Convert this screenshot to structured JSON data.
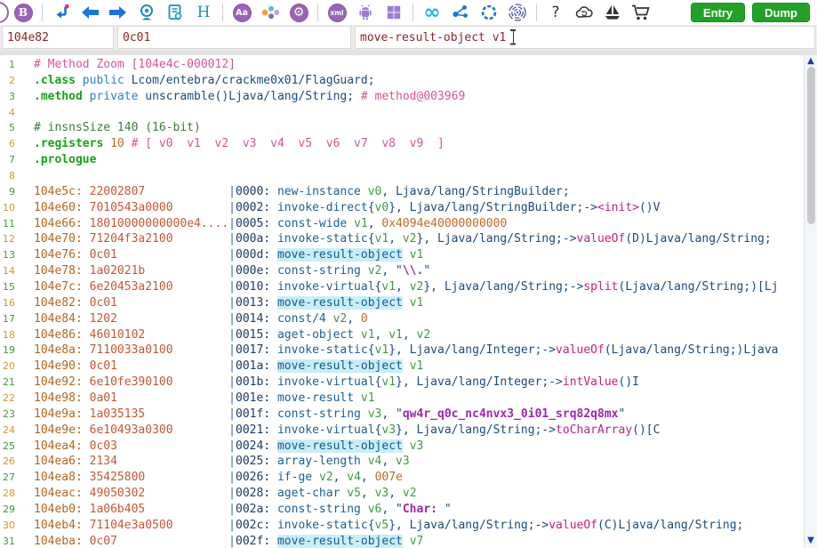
{
  "toolbar": {
    "glyphs": {
      "b_badge": "B",
      "font_case": "Aa",
      "settings_gear": "⚙",
      "xml_badge": "xml",
      "heading_h": "H",
      "infinity": "∞",
      "help": "?"
    },
    "buttons": [
      {
        "label": "Entry"
      },
      {
        "label": "Dump"
      }
    ]
  },
  "search": {
    "fields": [
      {
        "value": "104e82"
      },
      {
        "value": "0c01"
      },
      {
        "value": "move-result-object v1"
      }
    ]
  },
  "scrollbar": {
    "up": "▲",
    "down": "▼"
  },
  "colors": {
    "button_green": "#23a127",
    "search_text": "#8b2525",
    "highlight_bg": "#c9eef8",
    "accent_purple": "#9a63b5",
    "accent_teal": "#1f8fb5",
    "accent_blue": "#1b74d8"
  },
  "editor": {
    "highlight_term": "move-result-object",
    "lines": [
      {
        "no": 1,
        "tokens": [
          [
            "cpk",
            "# Method Zoom [104e4c-000012]"
          ]
        ]
      },
      {
        "no": 2,
        "tokens": [
          [
            "kw",
            ".class"
          ],
          [
            "pl",
            " "
          ],
          [
            "mod",
            "public"
          ],
          [
            "pl",
            " Lcom/entebra/crackme0x01/FlagGuard;"
          ]
        ]
      },
      {
        "no": 3,
        "tokens": [
          [
            "kw",
            ".method"
          ],
          [
            "pl",
            " "
          ],
          [
            "mod",
            "private"
          ],
          [
            "pl",
            " unscramble()Ljava/lang/String; "
          ],
          [
            "cpk",
            "# method@003969"
          ]
        ]
      },
      {
        "no": 4,
        "tokens": []
      },
      {
        "no": 5,
        "tokens": [
          [
            "cgr",
            "# insnsSize 140 (16-bit)"
          ]
        ]
      },
      {
        "no": 6,
        "tokens": [
          [
            "kw",
            ".registers"
          ],
          [
            "pl",
            " "
          ],
          [
            "num",
            "10"
          ],
          [
            "pl",
            " "
          ],
          [
            "cpk",
            "# [ v0  v1  v2  v3  v4  v5  v6  v7  v8  v9  ]"
          ]
        ]
      },
      {
        "no": 7,
        "tokens": [
          [
            "kw",
            ".prologue"
          ]
        ]
      },
      {
        "no": 8,
        "tokens": []
      },
      {
        "no": 9,
        "tokens": [
          [
            "addr",
            "104e5c: "
          ],
          [
            "bytes",
            "22002807            "
          ],
          [
            "pipe",
            "|"
          ],
          [
            "off",
            "0000: "
          ],
          [
            "op",
            "new-instance"
          ],
          [
            "pl",
            " "
          ],
          [
            "reg",
            "v0"
          ],
          [
            "pl",
            ", Ljava/lang/StringBuilder;"
          ]
        ]
      },
      {
        "no": 10,
        "tokens": [
          [
            "addr",
            "104e60: "
          ],
          [
            "bytes",
            "7010543a0000        "
          ],
          [
            "pipe",
            "|"
          ],
          [
            "off",
            "0002: "
          ],
          [
            "op",
            "invoke-direct"
          ],
          [
            "pl",
            "{"
          ],
          [
            "reg",
            "v0"
          ],
          [
            "pl",
            "}, Ljava/lang/StringBuilder;->"
          ],
          [
            "meth",
            "<init>"
          ],
          [
            "pl",
            "()V"
          ]
        ]
      },
      {
        "no": 11,
        "tokens": [
          [
            "addr",
            "104e66: "
          ],
          [
            "bytes",
            "18010000000000e4...."
          ],
          [
            "pipe",
            "|"
          ],
          [
            "off",
            "0005: "
          ],
          [
            "op",
            "const-wide"
          ],
          [
            "pl",
            " "
          ],
          [
            "reg",
            "v1"
          ],
          [
            "pl",
            ", "
          ],
          [
            "num",
            "0x4094e40000000000"
          ]
        ]
      },
      {
        "no": 12,
        "tokens": [
          [
            "addr",
            "104e70: "
          ],
          [
            "bytes",
            "71204f3a2100        "
          ],
          [
            "pipe",
            "|"
          ],
          [
            "off",
            "000a: "
          ],
          [
            "op",
            "invoke-static"
          ],
          [
            "pl",
            "{"
          ],
          [
            "reg",
            "v1"
          ],
          [
            "pl",
            ", "
          ],
          [
            "reg",
            "v2"
          ],
          [
            "pl",
            "}, Ljava/lang/String;->"
          ],
          [
            "meth",
            "valueOf"
          ],
          [
            "pl",
            "(D)Ljava/lang/String;"
          ]
        ]
      },
      {
        "no": 13,
        "tokens": [
          [
            "addr",
            "104e76: "
          ],
          [
            "bytes",
            "0c01                "
          ],
          [
            "pipe",
            "|"
          ],
          [
            "off",
            "000d: "
          ],
          [
            "ophl",
            "move-result-object"
          ],
          [
            "pl",
            " "
          ],
          [
            "reg",
            "v1"
          ]
        ]
      },
      {
        "no": 14,
        "tokens": [
          [
            "addr",
            "104e78: "
          ],
          [
            "bytes",
            "1a02021b            "
          ],
          [
            "pipe",
            "|"
          ],
          [
            "off",
            "000e: "
          ],
          [
            "op",
            "const-string"
          ],
          [
            "pl",
            " "
          ],
          [
            "reg",
            "v2"
          ],
          [
            "pl",
            ", \""
          ],
          [
            "str",
            "\\\\."
          ],
          [
            "pl",
            "\""
          ]
        ]
      },
      {
        "no": 15,
        "tokens": [
          [
            "addr",
            "104e7c: "
          ],
          [
            "bytes",
            "6e20453a2100        "
          ],
          [
            "pipe",
            "|"
          ],
          [
            "off",
            "0010: "
          ],
          [
            "op",
            "invoke-virtual"
          ],
          [
            "pl",
            "{"
          ],
          [
            "reg",
            "v1"
          ],
          [
            "pl",
            ", "
          ],
          [
            "reg",
            "v2"
          ],
          [
            "pl",
            "}, Ljava/lang/String;->"
          ],
          [
            "meth",
            "split"
          ],
          [
            "pl",
            "(Ljava/lang/String;)[Lj"
          ]
        ]
      },
      {
        "no": 16,
        "tokens": [
          [
            "addr",
            "104e82: "
          ],
          [
            "bytes",
            "0c01                "
          ],
          [
            "pipe",
            "|"
          ],
          [
            "off",
            "0013: "
          ],
          [
            "ophl",
            "move-result-object"
          ],
          [
            "pl",
            " "
          ],
          [
            "reg",
            "v1"
          ]
        ]
      },
      {
        "no": 17,
        "tokens": [
          [
            "addr",
            "104e84: "
          ],
          [
            "bytes",
            "1202                "
          ],
          [
            "pipe",
            "|"
          ],
          [
            "off",
            "0014: "
          ],
          [
            "op",
            "const/4"
          ],
          [
            "pl",
            " "
          ],
          [
            "reg",
            "v2"
          ],
          [
            "pl",
            ", "
          ],
          [
            "num",
            "0"
          ]
        ]
      },
      {
        "no": 18,
        "tokens": [
          [
            "addr",
            "104e86: "
          ],
          [
            "bytes",
            "46010102            "
          ],
          [
            "pipe",
            "|"
          ],
          [
            "off",
            "0015: "
          ],
          [
            "op",
            "aget-object"
          ],
          [
            "pl",
            " "
          ],
          [
            "reg",
            "v1"
          ],
          [
            "pl",
            ", "
          ],
          [
            "reg",
            "v1"
          ],
          [
            "pl",
            ", "
          ],
          [
            "reg",
            "v2"
          ]
        ]
      },
      {
        "no": 19,
        "tokens": [
          [
            "addr",
            "104e8a: "
          ],
          [
            "bytes",
            "7110033a0100        "
          ],
          [
            "pipe",
            "|"
          ],
          [
            "off",
            "0017: "
          ],
          [
            "op",
            "invoke-static"
          ],
          [
            "pl",
            "{"
          ],
          [
            "reg",
            "v1"
          ],
          [
            "pl",
            "}, Ljava/lang/Integer;->"
          ],
          [
            "meth",
            "valueOf"
          ],
          [
            "pl",
            "(Ljava/lang/String;)Ljava"
          ]
        ]
      },
      {
        "no": 20,
        "tokens": [
          [
            "addr",
            "104e90: "
          ],
          [
            "bytes",
            "0c01                "
          ],
          [
            "pipe",
            "|"
          ],
          [
            "off",
            "001a: "
          ],
          [
            "ophl",
            "move-result-object"
          ],
          [
            "pl",
            " "
          ],
          [
            "reg",
            "v1"
          ]
        ]
      },
      {
        "no": 21,
        "tokens": [
          [
            "addr",
            "104e92: "
          ],
          [
            "bytes",
            "6e10fe390100        "
          ],
          [
            "pipe",
            "|"
          ],
          [
            "off",
            "001b: "
          ],
          [
            "op",
            "invoke-virtual"
          ],
          [
            "pl",
            "{"
          ],
          [
            "reg",
            "v1"
          ],
          [
            "pl",
            "}, Ljava/lang/Integer;->"
          ],
          [
            "meth",
            "intValue"
          ],
          [
            "pl",
            "()I"
          ]
        ]
      },
      {
        "no": 22,
        "tokens": [
          [
            "addr",
            "104e98: "
          ],
          [
            "bytes",
            "0a01                "
          ],
          [
            "pipe",
            "|"
          ],
          [
            "off",
            "001e: "
          ],
          [
            "op",
            "move-result"
          ],
          [
            "pl",
            " "
          ],
          [
            "reg",
            "v1"
          ]
        ]
      },
      {
        "no": 23,
        "tokens": [
          [
            "addr",
            "104e9a: "
          ],
          [
            "bytes",
            "1a035135            "
          ],
          [
            "pipe",
            "|"
          ],
          [
            "off",
            "001f: "
          ],
          [
            "op",
            "const-string"
          ],
          [
            "pl",
            " "
          ],
          [
            "reg",
            "v3"
          ],
          [
            "pl",
            ", \""
          ],
          [
            "str",
            "qw4r_q0c_nc4nvx3_0i01_srq82q8mx"
          ],
          [
            "pl",
            "\""
          ]
        ]
      },
      {
        "no": 24,
        "tokens": [
          [
            "addr",
            "104e9e: "
          ],
          [
            "bytes",
            "6e10493a0300        "
          ],
          [
            "pipe",
            "|"
          ],
          [
            "off",
            "0021: "
          ],
          [
            "op",
            "invoke-virtual"
          ],
          [
            "pl",
            "{"
          ],
          [
            "reg",
            "v3"
          ],
          [
            "pl",
            "}, Ljava/lang/String;->"
          ],
          [
            "meth",
            "toCharArray"
          ],
          [
            "pl",
            "()[C"
          ]
        ]
      },
      {
        "no": 25,
        "tokens": [
          [
            "addr",
            "104ea4: "
          ],
          [
            "bytes",
            "0c03                "
          ],
          [
            "pipe",
            "|"
          ],
          [
            "off",
            "0024: "
          ],
          [
            "ophl",
            "move-result-object"
          ],
          [
            "pl",
            " "
          ],
          [
            "reg",
            "v3"
          ]
        ]
      },
      {
        "no": 26,
        "tokens": [
          [
            "addr",
            "104ea6: "
          ],
          [
            "bytes",
            "2134                "
          ],
          [
            "pipe",
            "|"
          ],
          [
            "off",
            "0025: "
          ],
          [
            "op",
            "array-length"
          ],
          [
            "pl",
            " "
          ],
          [
            "reg",
            "v4"
          ],
          [
            "pl",
            ", "
          ],
          [
            "reg",
            "v3"
          ]
        ]
      },
      {
        "no": 27,
        "tokens": [
          [
            "addr",
            "104ea8: "
          ],
          [
            "bytes",
            "35425800            "
          ],
          [
            "pipe",
            "|"
          ],
          [
            "off",
            "0026: "
          ],
          [
            "op",
            "if-ge"
          ],
          [
            "pl",
            " "
          ],
          [
            "reg",
            "v2"
          ],
          [
            "pl",
            ", "
          ],
          [
            "reg",
            "v4"
          ],
          [
            "pl",
            ", "
          ],
          [
            "num",
            "007e"
          ]
        ]
      },
      {
        "no": 28,
        "tokens": [
          [
            "addr",
            "104eac: "
          ],
          [
            "bytes",
            "49050302            "
          ],
          [
            "pipe",
            "|"
          ],
          [
            "off",
            "0028: "
          ],
          [
            "op",
            "aget-char"
          ],
          [
            "pl",
            " "
          ],
          [
            "reg",
            "v5"
          ],
          [
            "pl",
            ", "
          ],
          [
            "reg",
            "v3"
          ],
          [
            "pl",
            ", "
          ],
          [
            "reg",
            "v2"
          ]
        ]
      },
      {
        "no": 29,
        "tokens": [
          [
            "addr",
            "104eb0: "
          ],
          [
            "bytes",
            "1a06b405            "
          ],
          [
            "pipe",
            "|"
          ],
          [
            "off",
            "002a: "
          ],
          [
            "op",
            "const-string"
          ],
          [
            "pl",
            " "
          ],
          [
            "reg",
            "v6"
          ],
          [
            "pl",
            ", \""
          ],
          [
            "str",
            "Char: "
          ],
          [
            "pl",
            "\""
          ]
        ]
      },
      {
        "no": 30,
        "tokens": [
          [
            "addr",
            "104eb4: "
          ],
          [
            "bytes",
            "71104e3a0500        "
          ],
          [
            "pipe",
            "|"
          ],
          [
            "off",
            "002c: "
          ],
          [
            "op",
            "invoke-static"
          ],
          [
            "pl",
            "{"
          ],
          [
            "reg",
            "v5"
          ],
          [
            "pl",
            "}, Ljava/lang/String;->"
          ],
          [
            "meth",
            "valueOf"
          ],
          [
            "pl",
            "(C)Ljava/lang/String;"
          ]
        ]
      },
      {
        "no": 31,
        "tokens": [
          [
            "addr",
            "104eba: "
          ],
          [
            "bytes",
            "0c07                "
          ],
          [
            "pipe",
            "|"
          ],
          [
            "off",
            "002f: "
          ],
          [
            "ophl",
            "move-result-object"
          ],
          [
            "pl",
            " "
          ],
          [
            "reg",
            "v7"
          ]
        ]
      }
    ]
  }
}
